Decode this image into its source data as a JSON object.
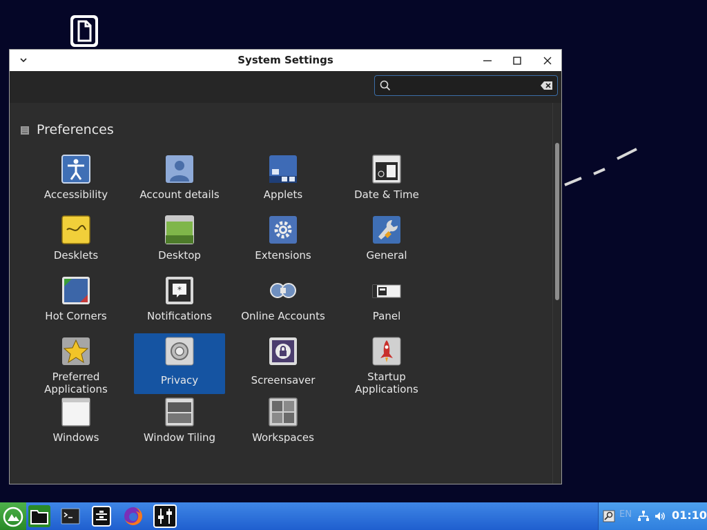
{
  "window": {
    "title": "System Settings"
  },
  "search": {
    "value": "",
    "placeholder": ""
  },
  "section": {
    "title": "Preferences"
  },
  "items": [
    {
      "label": "Accessibility",
      "icon": "accessibility-icon"
    },
    {
      "label": "Account details",
      "icon": "account-icon"
    },
    {
      "label": "Applets",
      "icon": "applets-icon"
    },
    {
      "label": "Date & Time",
      "icon": "calendar-icon"
    },
    {
      "label": "Desklets",
      "icon": "desklets-icon"
    },
    {
      "label": "Desktop",
      "icon": "desktop-icon"
    },
    {
      "label": "Extensions",
      "icon": "gear-icon"
    },
    {
      "label": "General",
      "icon": "wrench-icon"
    },
    {
      "label": "Hot Corners",
      "icon": "hot-corners-icon"
    },
    {
      "label": "Notifications",
      "icon": "notification-icon"
    },
    {
      "label": "Online Accounts",
      "icon": "online-accounts-icon"
    },
    {
      "label": "Panel",
      "icon": "panel-icon"
    },
    {
      "label": "Preferred\nApplications",
      "icon": "star-icon"
    },
    {
      "label": "Privacy",
      "icon": "privacy-icon",
      "selected": true
    },
    {
      "label": "Screensaver",
      "icon": "lock-icon"
    },
    {
      "label": "Startup\nApplications",
      "icon": "rocket-icon"
    },
    {
      "label": "Windows",
      "icon": "window-icon"
    },
    {
      "label": "Window Tiling",
      "icon": "window-tiling-icon"
    },
    {
      "label": "Workspaces",
      "icon": "workspaces-icon"
    }
  ],
  "tray": {
    "language": "EN",
    "clock": "01:10"
  },
  "colors": {
    "desktop": "#050627",
    "window_bg": "#2d2d2d",
    "selection": "#1554a2",
    "taskbar": "#2f70dc",
    "start": "#3a9d38"
  }
}
